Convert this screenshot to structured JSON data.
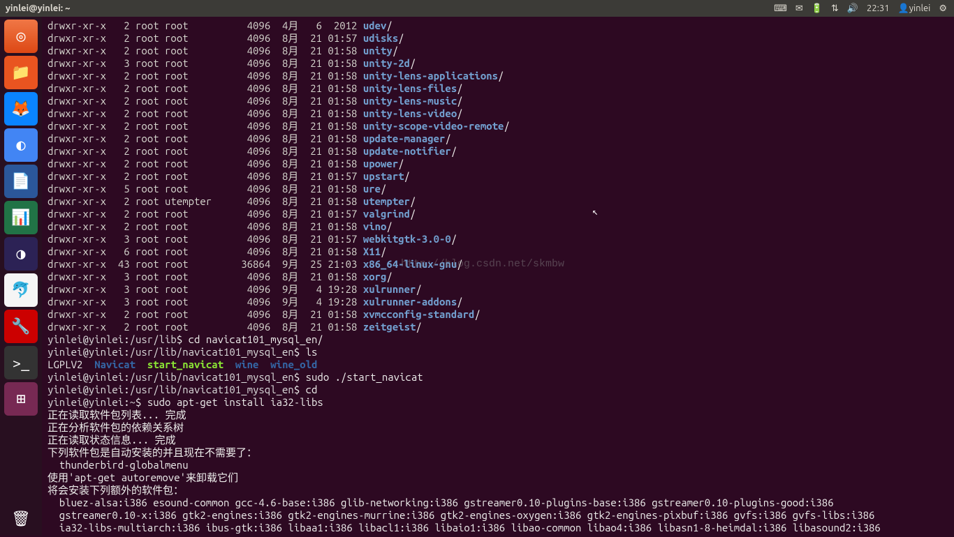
{
  "top": {
    "title": "yinlei@yinlei: ~",
    "time": "22:31",
    "user": "yinlei"
  },
  "watermark": "http://blog.csdn.net/skmbw",
  "ls": [
    {
      "p": "drwxr-xr-x",
      "l": "2",
      "o": "root",
      "g": "root",
      "s": "4096",
      "d": "4月   6  2012",
      "n": "udev"
    },
    {
      "p": "drwxr-xr-x",
      "l": "2",
      "o": "root",
      "g": "root",
      "s": "4096",
      "d": "8月  21 01:57",
      "n": "udisks"
    },
    {
      "p": "drwxr-xr-x",
      "l": "2",
      "o": "root",
      "g": "root",
      "s": "4096",
      "d": "8月  21 01:58",
      "n": "unity"
    },
    {
      "p": "drwxr-xr-x",
      "l": "3",
      "o": "root",
      "g": "root",
      "s": "4096",
      "d": "8月  21 01:58",
      "n": "unity-2d"
    },
    {
      "p": "drwxr-xr-x",
      "l": "2",
      "o": "root",
      "g": "root",
      "s": "4096",
      "d": "8月  21 01:58",
      "n": "unity-lens-applications"
    },
    {
      "p": "drwxr-xr-x",
      "l": "2",
      "o": "root",
      "g": "root",
      "s": "4096",
      "d": "8月  21 01:58",
      "n": "unity-lens-files"
    },
    {
      "p": "drwxr-xr-x",
      "l": "2",
      "o": "root",
      "g": "root",
      "s": "4096",
      "d": "8月  21 01:58",
      "n": "unity-lens-music"
    },
    {
      "p": "drwxr-xr-x",
      "l": "2",
      "o": "root",
      "g": "root",
      "s": "4096",
      "d": "8月  21 01:58",
      "n": "unity-lens-video"
    },
    {
      "p": "drwxr-xr-x",
      "l": "2",
      "o": "root",
      "g": "root",
      "s": "4096",
      "d": "8月  21 01:58",
      "n": "unity-scope-video-remote"
    },
    {
      "p": "drwxr-xr-x",
      "l": "2",
      "o": "root",
      "g": "root",
      "s": "4096",
      "d": "8月  21 01:58",
      "n": "update-manager"
    },
    {
      "p": "drwxr-xr-x",
      "l": "2",
      "o": "root",
      "g": "root",
      "s": "4096",
      "d": "8月  21 01:58",
      "n": "update-notifier"
    },
    {
      "p": "drwxr-xr-x",
      "l": "2",
      "o": "root",
      "g": "root",
      "s": "4096",
      "d": "8月  21 01:58",
      "n": "upower"
    },
    {
      "p": "drwxr-xr-x",
      "l": "2",
      "o": "root",
      "g": "root",
      "s": "4096",
      "d": "8月  21 01:57",
      "n": "upstart"
    },
    {
      "p": "drwxr-xr-x",
      "l": "5",
      "o": "root",
      "g": "root",
      "s": "4096",
      "d": "8月  21 01:58",
      "n": "ure"
    },
    {
      "p": "drwxr-xr-x",
      "l": "2",
      "o": "root",
      "g": "utempter",
      "s": "4096",
      "d": "8月  21 01:58",
      "n": "utempter"
    },
    {
      "p": "drwxr-xr-x",
      "l": "2",
      "o": "root",
      "g": "root",
      "s": "4096",
      "d": "8月  21 01:57",
      "n": "valgrind"
    },
    {
      "p": "drwxr-xr-x",
      "l": "2",
      "o": "root",
      "g": "root",
      "s": "4096",
      "d": "8月  21 01:58",
      "n": "vino"
    },
    {
      "p": "drwxr-xr-x",
      "l": "3",
      "o": "root",
      "g": "root",
      "s": "4096",
      "d": "8月  21 01:57",
      "n": "webkitgtk-3.0-0"
    },
    {
      "p": "drwxr-xr-x",
      "l": "6",
      "o": "root",
      "g": "root",
      "s": "4096",
      "d": "8月  21 01:58",
      "n": "X11"
    },
    {
      "p": "drwxr-xr-x",
      "l": "43",
      "o": "root",
      "g": "root",
      "s": "36864",
      "d": "9月  25 21:03",
      "n": "x86_64-linux-gnu"
    },
    {
      "p": "drwxr-xr-x",
      "l": "3",
      "o": "root",
      "g": "root",
      "s": "4096",
      "d": "8月  21 01:58",
      "n": "xorg"
    },
    {
      "p": "drwxr-xr-x",
      "l": "3",
      "o": "root",
      "g": "root",
      "s": "4096",
      "d": "9月   4 19:28",
      "n": "xulrunner"
    },
    {
      "p": "drwxr-xr-x",
      "l": "3",
      "o": "root",
      "g": "root",
      "s": "4096",
      "d": "9月   4 19:28",
      "n": "xulrunner-addons"
    },
    {
      "p": "drwxr-xr-x",
      "l": "2",
      "o": "root",
      "g": "root",
      "s": "4096",
      "d": "8月  21 01:58",
      "n": "xvmcconfig-standard"
    },
    {
      "p": "drwxr-xr-x",
      "l": "2",
      "o": "root",
      "g": "root",
      "s": "4096",
      "d": "8月  21 01:58",
      "n": "zeitgeist"
    }
  ],
  "prompts": [
    {
      "user": "yinlei@yinlei",
      "path": "/usr/lib",
      "cmd": "cd navicat101_mysql_en/"
    },
    {
      "user": "yinlei@yinlei",
      "path": "/usr/lib/navicat101_mysql_en",
      "cmd": "ls"
    }
  ],
  "ls2": {
    "lgp": "LGPLV2",
    "nav": "Navicat",
    "start": "start_navicat",
    "wine": "wine",
    "wineold": "wine_old"
  },
  "prompts2": [
    {
      "user": "yinlei@yinlei",
      "path": "/usr/lib/navicat101_mysql_en",
      "cmd": "sudo ./start_navicat"
    },
    {
      "user": "yinlei@yinlei",
      "path": "/usr/lib/navicat101_mysql_en",
      "cmd": "cd"
    },
    {
      "user": "yinlei@yinlei",
      "path": "~",
      "cmd": "sudo apt-get install ia32-libs"
    }
  ],
  "apt": {
    "l1": "正在读取软件包列表... 完成",
    "l2": "正在分析软件包的依赖关系树",
    "l3": "正在读取状态信息... 完成",
    "l4": "下列软件包是自动安装的并且现在不需要了：",
    "l5": "  thunderbird-globalmenu",
    "l6": "使用'apt-get autoremove'来卸载它们",
    "l7": "将会安装下列额外的软件包：",
    "p1": "  bluez-alsa:i386 esound-common gcc-4.6-base:i386 glib-networking:i386 gstreamer0.10-plugins-base:i386 gstreamer0.10-plugins-good:i386",
    "p2": "  gstreamer0.10-x:i386 gtk2-engines:i386 gtk2-engines-murrine:i386 gtk2-engines-oxygen:i386 gtk2-engines-pixbuf:i386 gvfs:i386 gvfs-libs:i386",
    "p3": "  ia32-libs-multiarch:i386 ibus-gtk:i386 libaa1:i386 libacl1:i386 libaio1:i386 libao-common libao4:i386 libasn1-8-heimdal:i386 libasound2:i386"
  }
}
